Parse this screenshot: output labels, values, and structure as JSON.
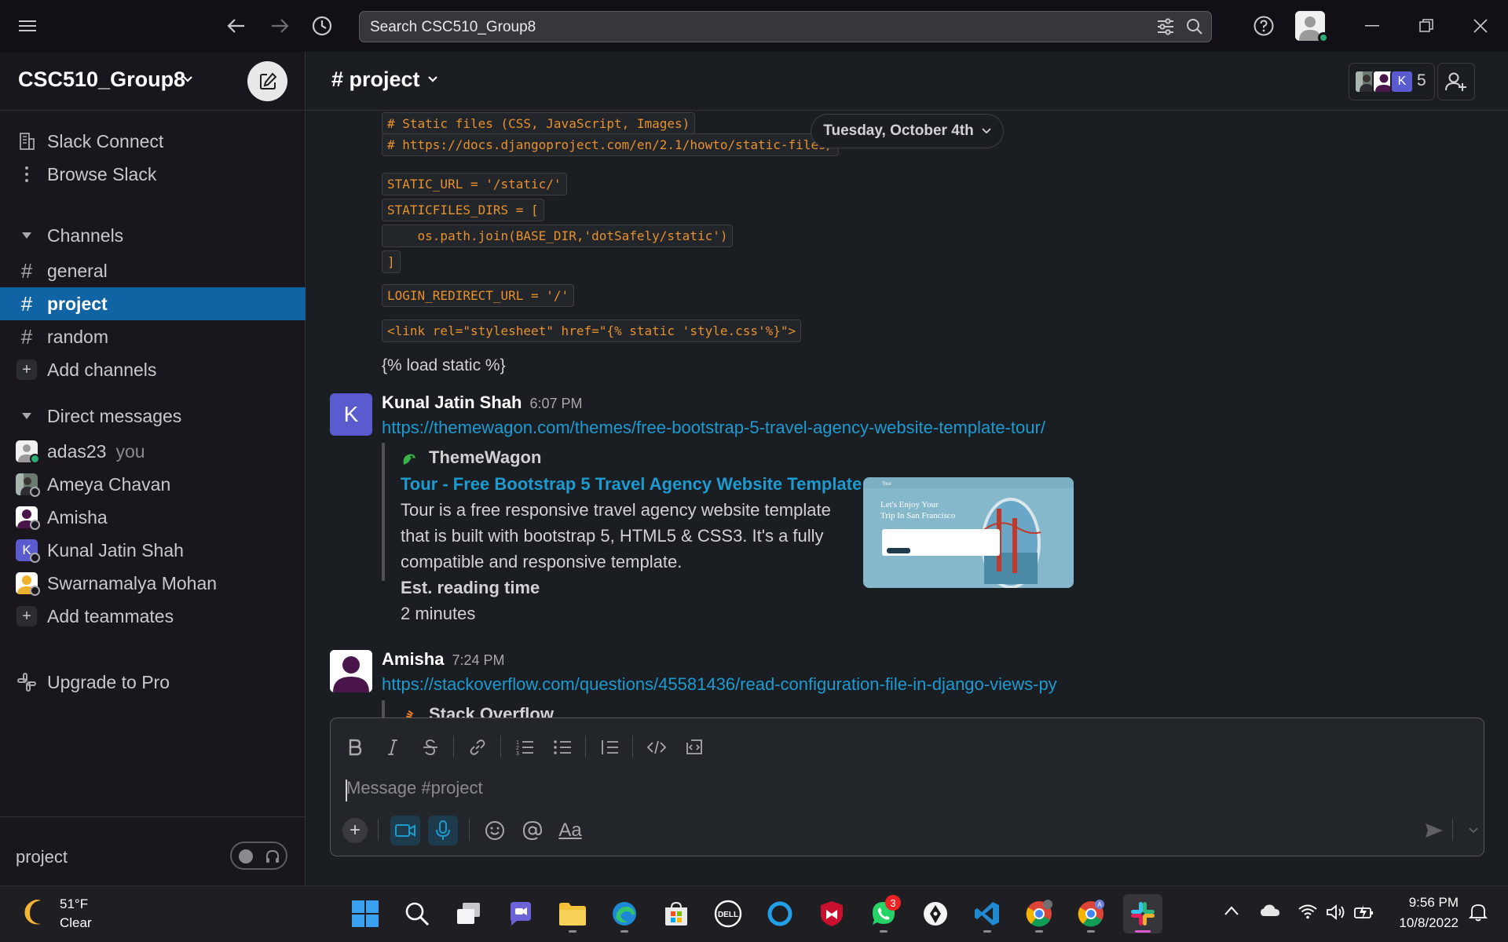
{
  "search": {
    "placeholder": "Search CSC510_Group8"
  },
  "workspace": {
    "name": "CSC510_Group8"
  },
  "sidebar": {
    "top_items": [
      {
        "label": "Slack Connect",
        "icon": "building-icon"
      },
      {
        "label": "Browse Slack",
        "icon": "more-vertical-icon"
      }
    ],
    "channels_header": "Channels",
    "channels": [
      {
        "label": "general",
        "active": false
      },
      {
        "label": "project",
        "active": true
      },
      {
        "label": "random",
        "active": false
      }
    ],
    "add_channels": "Add channels",
    "dm_header": "Direct messages",
    "dms": [
      {
        "label": "adas23",
        "suffix": "you"
      },
      {
        "label": "Ameya Chavan"
      },
      {
        "label": "Amisha"
      },
      {
        "label": "Kunal Jatin Shah"
      },
      {
        "label": "Swarnamalya Mohan"
      }
    ],
    "add_teammates": "Add teammates",
    "upgrade": "Upgrade to Pro",
    "huddle_channel": "project"
  },
  "channel": {
    "name": "# project",
    "member_count": "5",
    "member_avatar_letter": "K"
  },
  "messages": {
    "date_divider": "Tuesday, October 4th",
    "code_lines": [
      "# Static files (CSS, JavaScript, Images)",
      "# https://docs.djangoproject.com/en/2.1/howto/static-files/",
      "STATIC_URL = '/static/'",
      "STATICFILES_DIRS = [",
      "    os.path.join(BASE_DIR,'dotSafely/static')",
      "]",
      "LOGIN_REDIRECT_URL = '/'",
      "<link rel=\"stylesheet\" href=\"{% static 'style.css'%}\">"
    ],
    "plain_line": "{% load static %}",
    "msg1": {
      "author": "Kunal Jatin Shah",
      "avatar_letter": "K",
      "time": "6:07 PM",
      "link": "https://themewagon.com/themes/free-bootstrap-5-travel-agency-website-template-tour/",
      "unfurl_site": "ThemeWagon",
      "unfurl_title": "Tour - Free Bootstrap 5 Travel Agency Website Template",
      "unfurl_desc": "Tour is a free responsive travel agency website template that is built with bootstrap 5, HTML5 & CSS3. It's a fully compatible and responsive template.",
      "field_label": "Est. reading time",
      "field_value": "2 minutes",
      "thumb_text_1": "Let's Enjoy Your",
      "thumb_text_2": "Trip In San Francisco",
      "thumb_brand": "Tour"
    },
    "msg2": {
      "author": "Amisha",
      "time": "7:24 PM",
      "link": "https://stackoverflow.com/questions/45581436/read-configuration-file-in-django-views-py",
      "unfurl_site": "Stack Overflow"
    }
  },
  "composer": {
    "placeholder": "Message #project",
    "format_label": "Aa"
  },
  "taskbar": {
    "weather_temp": "51°F",
    "weather_cond": "Clear",
    "whatsapp_badge": "3",
    "chrome_profile_letter": "A",
    "dell_label": "DELL",
    "time": "9:56 PM",
    "date": "10/8/2022"
  },
  "colors": {
    "accent": "#1164a3",
    "link": "#1d9bd1",
    "code": "#e8912d",
    "online": "#2bac76"
  }
}
